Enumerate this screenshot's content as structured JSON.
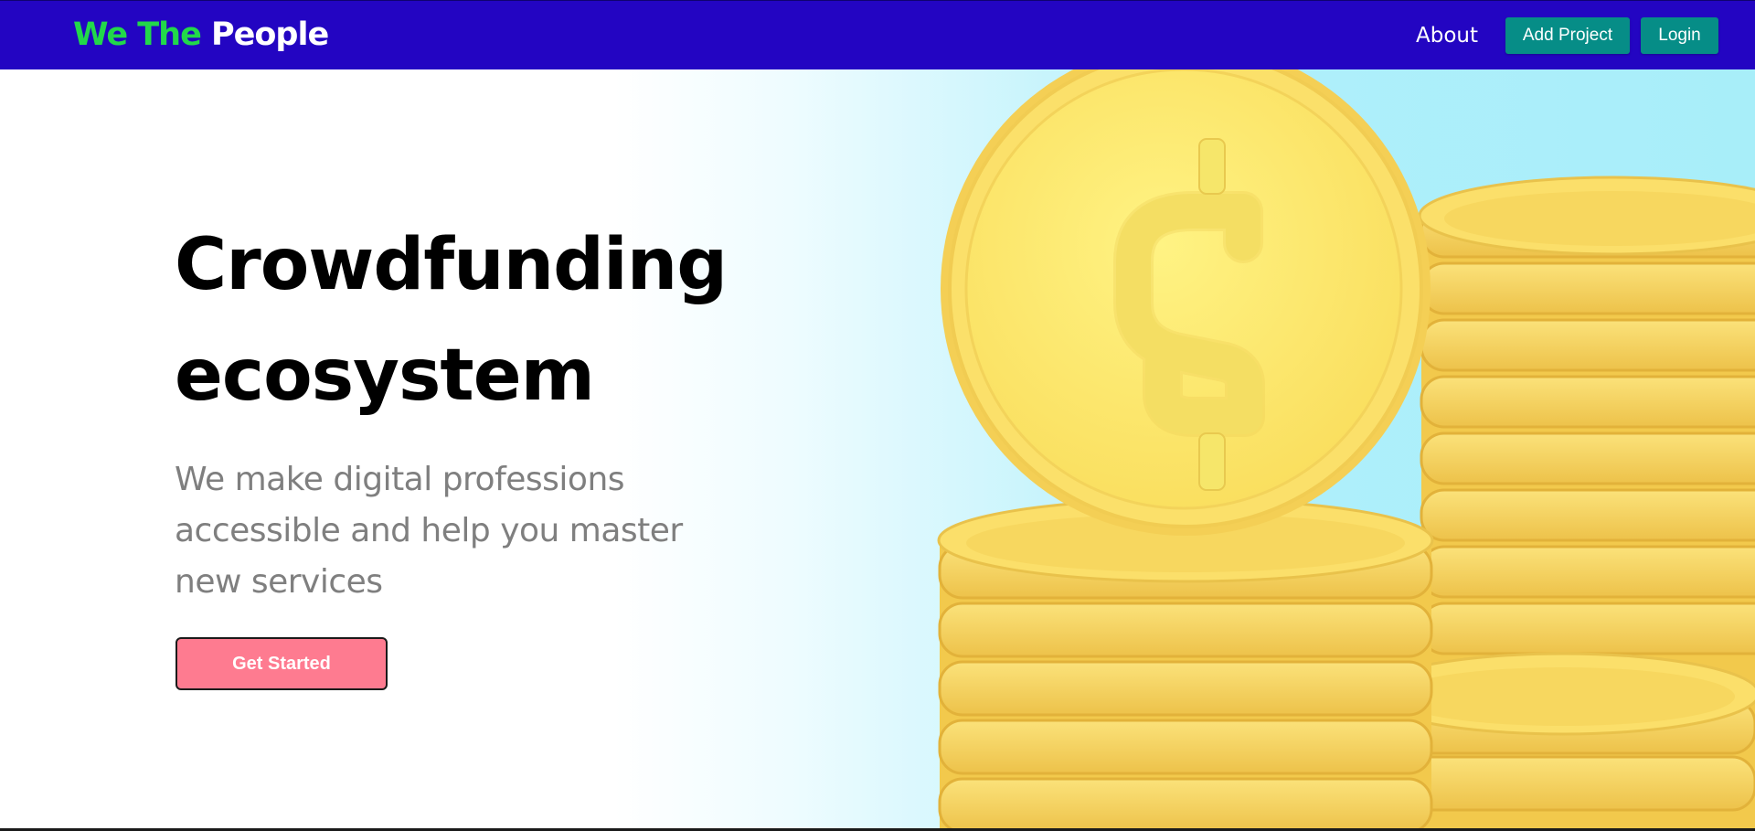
{
  "navbar": {
    "brand_part1": "We The",
    "brand_part2": "People",
    "about_label": "About",
    "add_project_label": "Add Project",
    "login_label": "Login"
  },
  "hero": {
    "title_line1": "Crowdfunding",
    "title_line2": "ecosystem",
    "subtitle_line1": "We make digital professions",
    "subtitle_line2": "accessible and help you master",
    "subtitle_line3": "new services",
    "cta_label": "Get Started",
    "illustration_icon": "dollar-coin-stack-icon"
  },
  "colors": {
    "navbar_bg": "#2305c2",
    "brand_green": "#22d84a",
    "nav_button": "#068d87",
    "cta_button": "#fe7b90",
    "hero_gradient_end": "#a8eef9",
    "coin_gold": "#fbd85a"
  }
}
